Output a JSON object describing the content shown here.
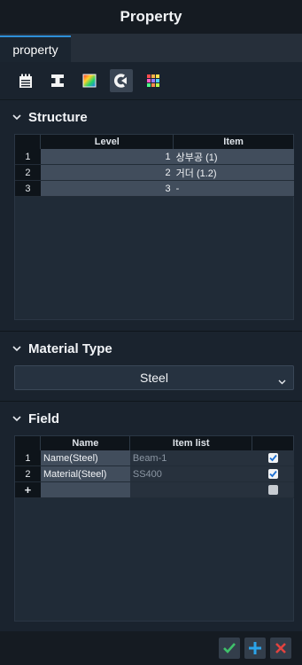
{
  "window": {
    "title": "Property"
  },
  "tabs": [
    {
      "label": "property"
    }
  ],
  "toolbar": {
    "icons": [
      "notepad-icon",
      "i-beam-icon",
      "color-gradient-icon",
      "refresh-arrow-icon",
      "color-grid-icon"
    ],
    "active_index": 3
  },
  "structure": {
    "title": "Structure",
    "columns": [
      "Level",
      "Item"
    ],
    "rows": [
      {
        "num": "1",
        "level": "1",
        "item": "상부공 (1)"
      },
      {
        "num": "2",
        "level": "2",
        "item": "거더 (1.2)"
      },
      {
        "num": "3",
        "level": "3",
        "item": "-"
      }
    ]
  },
  "material_type": {
    "title": "Material Type",
    "selected": "Steel"
  },
  "field": {
    "title": "Field",
    "columns": [
      "Name",
      "Item list",
      ""
    ],
    "rows": [
      {
        "num": "1",
        "name": "Name(Steel)",
        "item_list": "Beam-1",
        "checked": true
      },
      {
        "num": "2",
        "name": "Material(Steel)",
        "item_list": "SS400",
        "checked": true
      }
    ],
    "new_row_marker": "+"
  },
  "colors": {
    "accent_blue": "#2e8fd8",
    "confirm_green": "#3fc16a",
    "add_blue": "#2ba4ea",
    "cancel_red": "#e2433f"
  }
}
